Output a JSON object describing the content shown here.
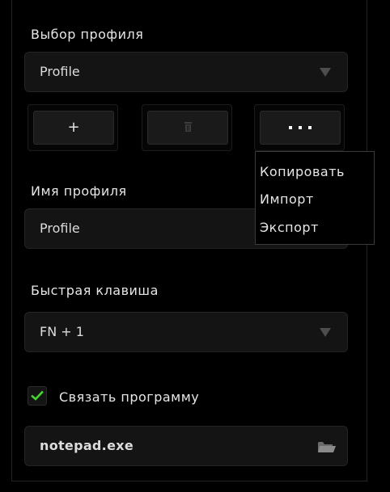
{
  "profile_select": {
    "label": "Выбор профиля",
    "value": "Profile",
    "arrow_icon": "triangle-down-icon"
  },
  "profile_buttons": {
    "add_label": "+",
    "delete_icon": "trash-icon",
    "more_icon": "ellipsis-icon"
  },
  "more_menu": {
    "items": [
      "Копировать",
      "Импорт",
      "Экспорт"
    ]
  },
  "profile_name": {
    "label": "Имя профиля",
    "value": "Profile"
  },
  "hotkey": {
    "label": "Быстрая клавиша",
    "value": "FN + 1",
    "arrow_icon": "triangle-down-icon"
  },
  "link_program": {
    "checked": true,
    "label": "Связать программу",
    "value": "notepad.exe",
    "folder_icon": "folder-icon"
  },
  "colors": {
    "accent_green": "#44d62c",
    "background": "#000000",
    "field_bg": "#141414",
    "text": "#e6e6e6"
  }
}
